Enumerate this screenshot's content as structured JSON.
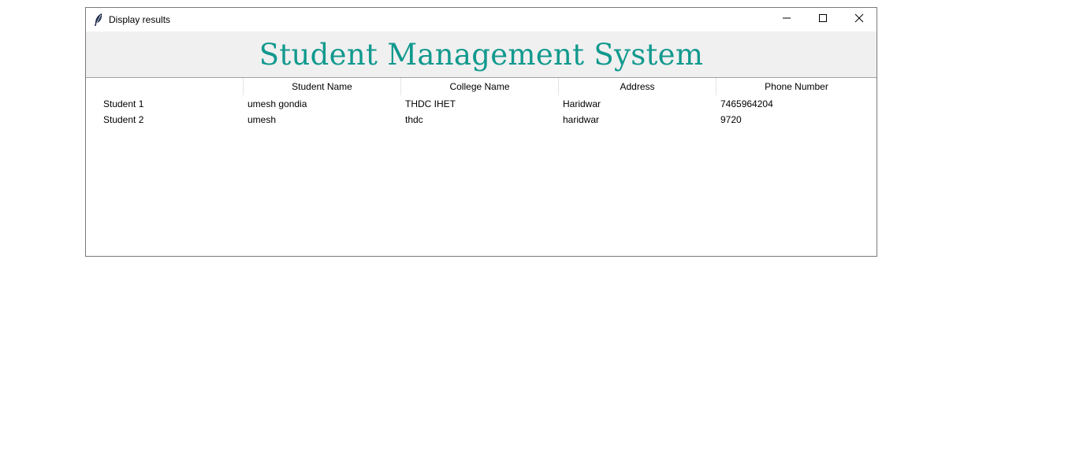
{
  "window": {
    "title": "Display results",
    "app_icon": "feather-icon",
    "controls": {
      "minimize_icon": "minimize-icon",
      "maximize_icon": "maximize-icon",
      "close_icon": "close-icon"
    }
  },
  "banner": {
    "title": "Student Management System",
    "title_color": "#11998e",
    "background": "#f0f0f0"
  },
  "table": {
    "columns": [
      "",
      "Student Name",
      "College Name",
      "Address",
      "Phone Number"
    ],
    "rows": [
      [
        "Student 1",
        "umesh gondia",
        "THDC IHET",
        "Haridwar",
        "7465964204"
      ],
      [
        "Student 2",
        "umesh",
        "thdc",
        "haridwar",
        "9720"
      ]
    ]
  }
}
